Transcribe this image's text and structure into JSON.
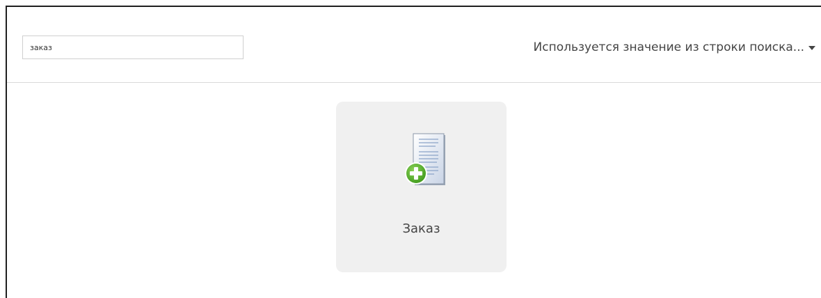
{
  "search": {
    "value": "заказ",
    "placeholder": ""
  },
  "mode_selector": {
    "label": "Используется значение из строки поиска...",
    "caret_icon": "caret-down-icon"
  },
  "results": [
    {
      "label": "Заказ",
      "icon": "document-add-icon",
      "colors": {
        "plus_badge": "#5aae2e",
        "document_lines": "#8aa3c8"
      }
    }
  ]
}
